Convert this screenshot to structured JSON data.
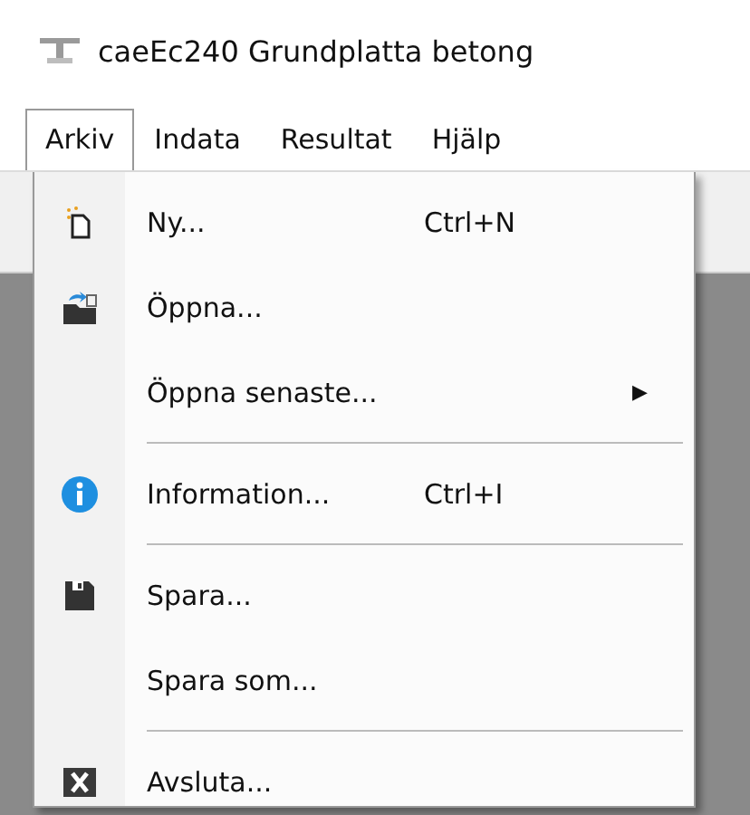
{
  "window": {
    "title": "caeEc240 Grundplatta betong"
  },
  "menubar": [
    {
      "label": "Arkiv",
      "selected": true
    },
    {
      "label": "Indata",
      "selected": false
    },
    {
      "label": "Resultat",
      "selected": false
    },
    {
      "label": "Hjälp",
      "selected": false
    }
  ],
  "menu": [
    {
      "kind": "item",
      "label": "Ny...",
      "shortcut": "Ctrl+N"
    },
    {
      "kind": "item",
      "label": "Öppna..."
    },
    {
      "kind": "submenu",
      "label": "Öppna senaste...",
      "arrow": "▶"
    },
    {
      "kind": "separator"
    },
    {
      "kind": "item",
      "label": "Information...",
      "shortcut": "Ctrl+I"
    },
    {
      "kind": "separator"
    },
    {
      "kind": "item",
      "label": "Spara..."
    },
    {
      "kind": "item",
      "label": "Spara som..."
    },
    {
      "kind": "separator"
    },
    {
      "kind": "item",
      "label": "Avsluta..."
    }
  ]
}
